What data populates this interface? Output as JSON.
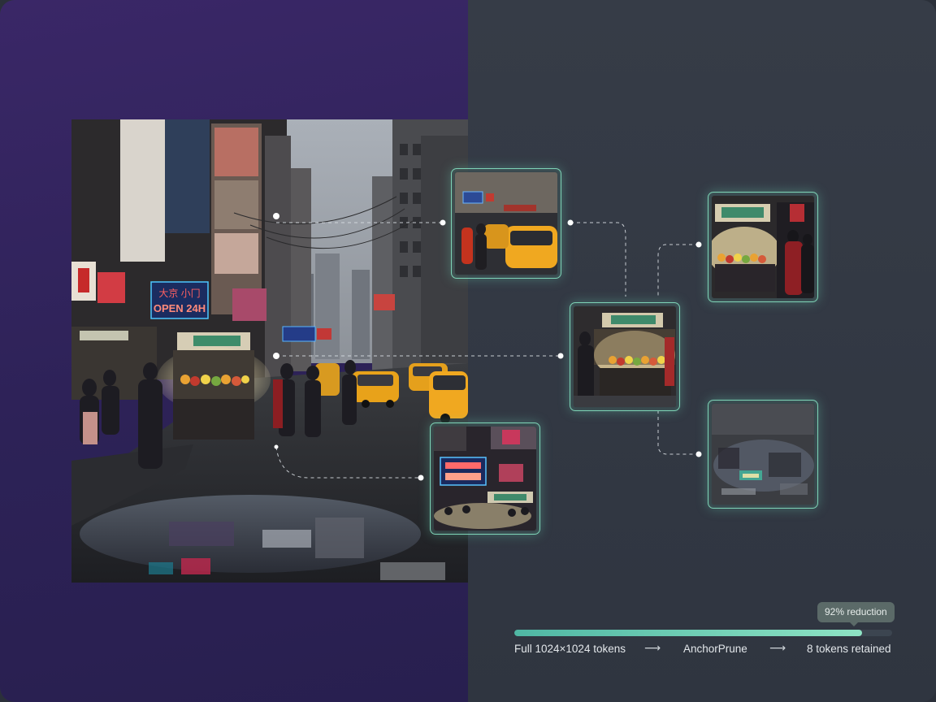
{
  "scene": {
    "signs": {
      "open": "OPEN 24H",
      "korean": "大京 小冂"
    }
  },
  "pipeline": {
    "reduction_badge": "92% reduction",
    "reduction_fraction": 0.92,
    "steps": [
      {
        "label": "Full 1024×1024 tokens"
      },
      {
        "label": "AnchorPrune"
      },
      {
        "label": "8 tokens retained"
      }
    ],
    "arrow_icon": "long-right-arrow-icon"
  },
  "colors": {
    "accent": "#7ed3b6",
    "left_bg": "#2d2257",
    "right_bg": "#323943",
    "progress": "#6fd0b5"
  }
}
